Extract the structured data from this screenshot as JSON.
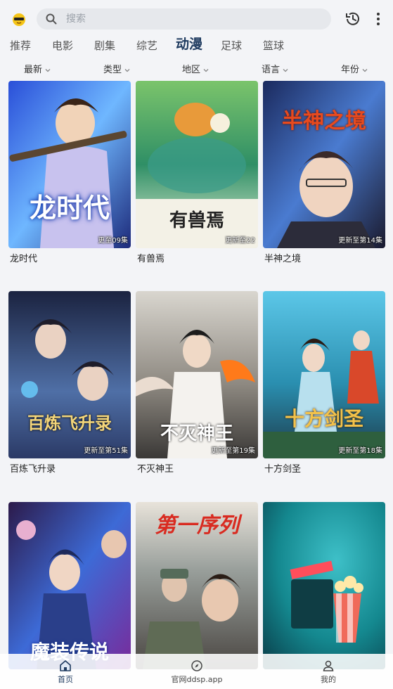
{
  "header": {
    "search_placeholder": "搜索",
    "icons": {
      "logo": "bee-face-icon",
      "search": "search-icon",
      "history": "history-icon",
      "more": "more-vertical-icon"
    }
  },
  "tabs": [
    "推荐",
    "电影",
    "剧集",
    "综艺",
    "动漫",
    "足球",
    "篮球"
  ],
  "active_tab": "动漫",
  "filters": [
    "最新",
    "类型",
    "地区",
    "语言",
    "年份"
  ],
  "items": [
    {
      "title": "龙时代",
      "badge": "更至09集",
      "poster_text": "龙时代"
    },
    {
      "title": "有兽焉",
      "badge": "更新至22",
      "poster_text": "有兽焉"
    },
    {
      "title": "半神之境",
      "badge": "更新至第14集",
      "poster_text": "半神之境"
    },
    {
      "title": "百炼飞升录",
      "badge": "更新至第51集",
      "poster_text": "百炼飞升录"
    },
    {
      "title": "不灭神王",
      "badge": "更新至第19集",
      "poster_text": "不灭神王"
    },
    {
      "title": "十方剑圣",
      "badge": "更新至第18集",
      "poster_text": "十方剑圣"
    },
    {
      "title": "",
      "badge": "",
      "poster_text": "魔装传说"
    },
    {
      "title": "",
      "badge": "",
      "poster_text": "第一序列"
    },
    {
      "title": "",
      "badge": "",
      "poster_text": ""
    }
  ],
  "bottom_nav": [
    {
      "label": "首页",
      "icon": "home-icon"
    },
    {
      "label": "官网ddsp.app",
      "icon": "compass-icon"
    },
    {
      "label": "我的",
      "icon": "user-icon"
    }
  ],
  "colors": {
    "accent": "#1e3a5f",
    "background": "#f3f4f7"
  }
}
